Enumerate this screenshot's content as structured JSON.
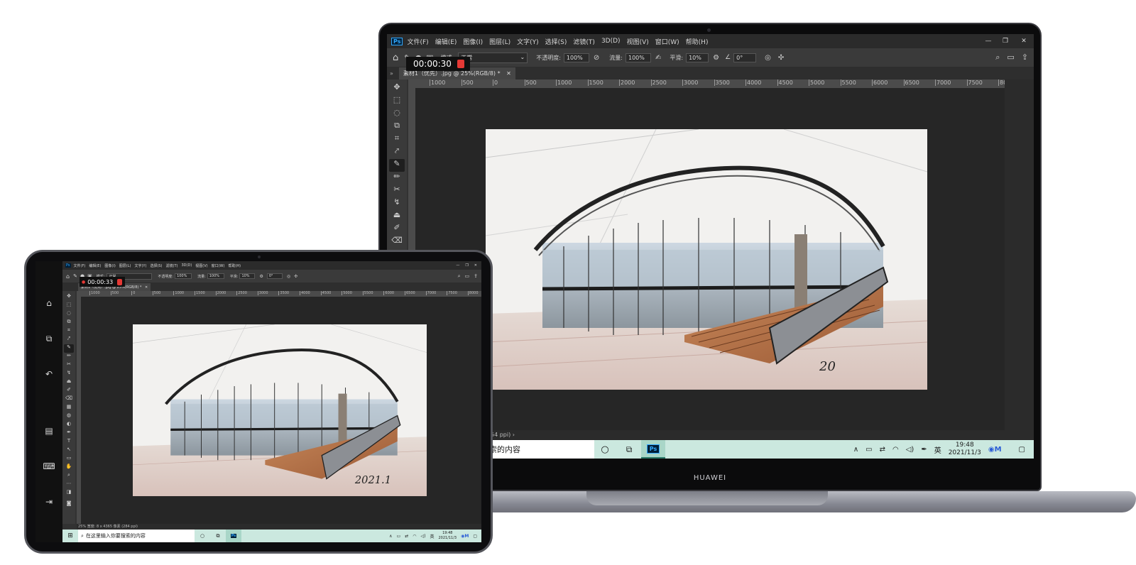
{
  "photoshop": {
    "menu": [
      "文件(F)",
      "编辑(E)",
      "图像(I)",
      "图层(L)",
      "文字(Y)",
      "选择(S)",
      "滤镜(T)",
      "3D(D)",
      "视图(V)",
      "窗口(W)",
      "帮助(H)"
    ],
    "options": {
      "mode_label": "模式:",
      "mode_value": "正常",
      "opacity_label": "不透明度:",
      "opacity_value": "100%",
      "flow_label": "流量:",
      "flow_value": "100%",
      "smooth_label": "平滑:",
      "smooth_value": "10%",
      "angle_value": "0°"
    },
    "doc_tab": "素材1（优先）.jpg @ 25%(RGB/8) *",
    "ruler_ticks": [
      "1000",
      "500",
      "0",
      "500",
      "1000",
      "1500",
      "2000",
      "2500",
      "3000",
      "3500",
      "4000",
      "4500",
      "5000",
      "5500",
      "6000",
      "6500",
      "7000",
      "7500",
      "8000"
    ],
    "status_laptop": "54 ppi)",
    "status_tablet": "25%   宽度: 8 x 4365 像素 (284 ppi)",
    "sketch_signature_laptop": "20",
    "sketch_signature_tablet": "2021.1"
  },
  "recorder": {
    "laptop_time": "00:00:30",
    "tablet_time": "00:00:33"
  },
  "taskbar": {
    "search_placeholder": "在这里输入你要搜索的内容",
    "search_partial": "索的内容",
    "ps_label": "Ps",
    "ime": "英",
    "time": "19:48",
    "date": "2021/11/3"
  },
  "laptop": {
    "brand": "HUAWEI"
  },
  "colors": {
    "ps_bg": "#323232",
    "taskbar_bg": "#cbe8df",
    "ps_blue": "#31a8ff",
    "record_red": "#e53935"
  }
}
